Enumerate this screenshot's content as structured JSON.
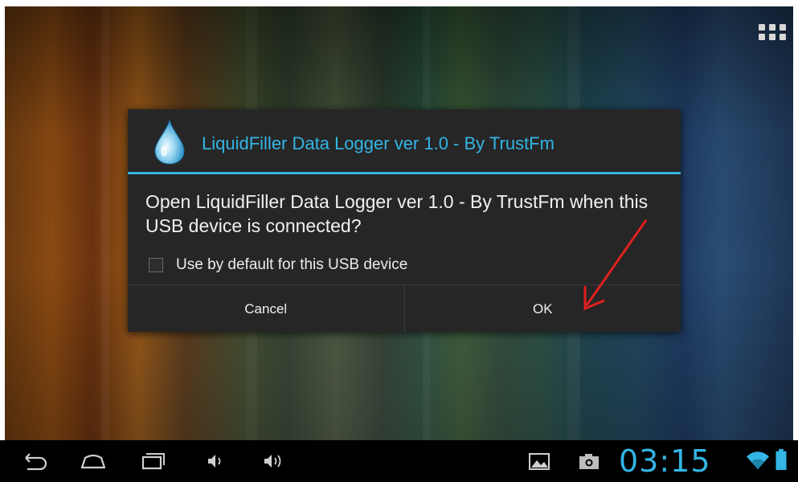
{
  "dialog": {
    "title": "LiquidFiller Data Logger ver 1.0 - By TrustFm",
    "app_icon": "water-drop-icon",
    "message": "Open LiquidFiller Data Logger ver 1.0 - By TrustFm when this USB device is connected?",
    "checkbox": {
      "label": "Use by default for this USB device",
      "checked": false
    },
    "cancel_label": "Cancel",
    "ok_label": "OK"
  },
  "home": {
    "apps_icon": "apps-grid-icon"
  },
  "navbar": {
    "buttons": [
      "back-icon",
      "home-icon",
      "recent-apps-icon",
      "volume-down-icon",
      "volume-up-icon"
    ],
    "notifications": [
      "image-icon",
      "camera-icon"
    ],
    "time": "03:15",
    "status_icons": [
      "wifi-icon",
      "battery-icon"
    ]
  },
  "colors": {
    "accent": "#33b5e5",
    "dialog_bg": "#262626",
    "annotation": "#e0201e"
  }
}
